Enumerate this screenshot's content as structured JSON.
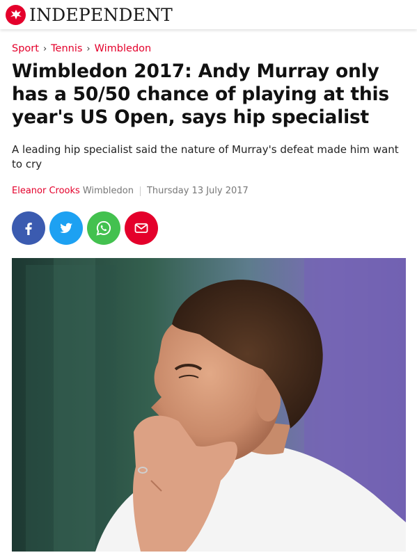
{
  "site": {
    "brand": "INDEPENDENT",
    "logo_icon": "eagle-icon",
    "accent": "#e4002b"
  },
  "breadcrumb": [
    "Sport",
    "Tennis",
    "Wimbledon"
  ],
  "headline": "Wimbledon 2017: Andy Murray only has a 50/50 chance of playing at this year's US Open, says hip specialist",
  "standfirst": "A leading hip specialist said the nature of Murray's defeat made him want to cry",
  "byline": {
    "author": "Eleanor Crooks",
    "location": "Wimbledon",
    "date": "Thursday 13 July 2017"
  },
  "share_buttons": [
    {
      "icon": "facebook-icon",
      "color": "#3b5bb0"
    },
    {
      "icon": "twitter-icon",
      "color": "#1da1f2"
    },
    {
      "icon": "whatsapp-icon",
      "color": "#43c14f"
    },
    {
      "icon": "email-icon",
      "color": "#e4002b"
    }
  ]
}
